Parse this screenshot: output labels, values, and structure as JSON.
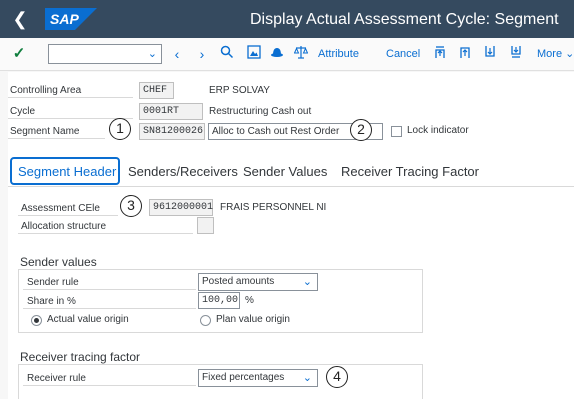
{
  "header": {
    "back_icon": "chevron-left-icon",
    "logo_text": "SAP",
    "title": "Display Actual Assessment Cycle: Segment"
  },
  "toolbar": {
    "command_value": "",
    "attribute_label": "Attribute",
    "cancel_label": "Cancel",
    "more_label": "More"
  },
  "header_fields": {
    "controlling_area_label": "Controlling Area",
    "controlling_area_value": "CHEF",
    "controlling_area_desc": "ERP SOLVAY",
    "cycle_label": "Cycle",
    "cycle_value": "0001RT",
    "cycle_desc": "Restructuring Cash out",
    "segment_name_label": "Segment Name",
    "segment_name_value": "SN81200026",
    "segment_name_desc": "Alloc to Cash out Rest Order",
    "lock_label": "Lock indicator"
  },
  "annotations": [
    "1",
    "2",
    "3",
    "4"
  ],
  "tabs": [
    "Segment Header",
    "Senders/Receivers",
    "Sender Values",
    "Receiver Tracing Factor"
  ],
  "segment_header": {
    "assessment_label": "Assessment CEle",
    "assessment_value": "9612000001",
    "assessment_desc": "FRAIS PERSONNEL NI",
    "allocation_label": "Allocation structure",
    "allocation_value": ""
  },
  "sender_values": {
    "title": "Sender values",
    "rule_label": "Sender rule",
    "rule_value": "Posted amounts",
    "share_label": "Share in %",
    "share_value": "100,00",
    "share_unit": "%",
    "actual_origin": "Actual value origin",
    "plan_origin": "Plan value origin"
  },
  "receiver_tracing": {
    "title": "Receiver tracing factor",
    "rule_label": "Receiver rule",
    "rule_value": "Fixed percentages"
  }
}
